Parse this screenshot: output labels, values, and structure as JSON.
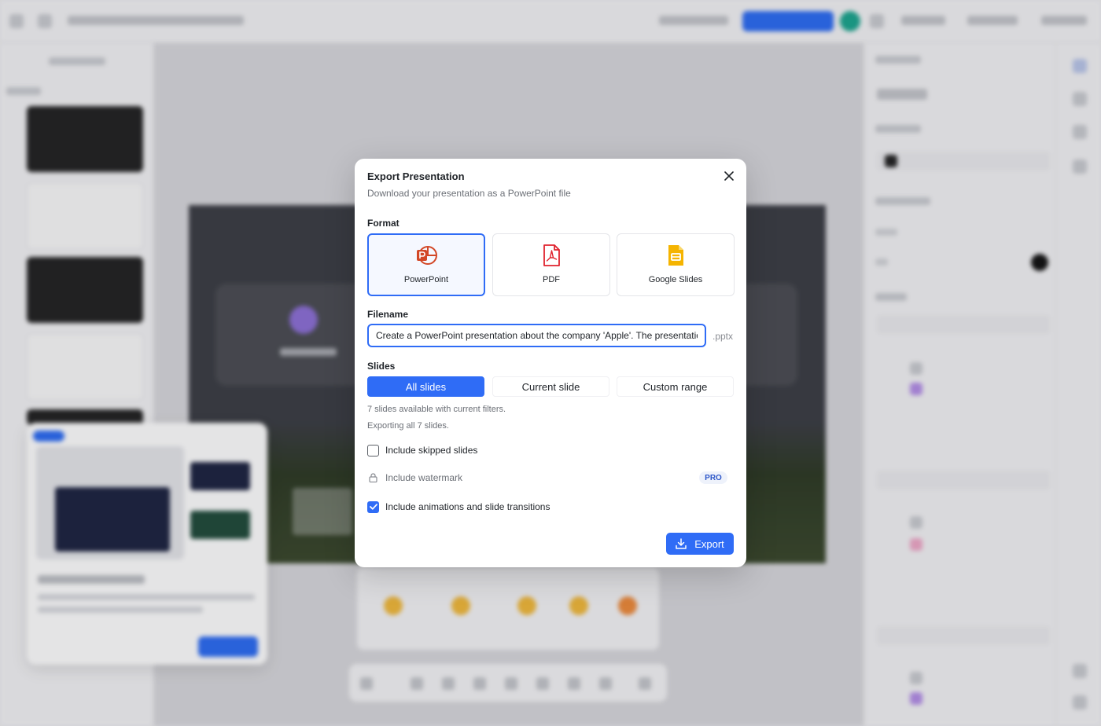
{
  "dialog": {
    "title": "Export Presentation",
    "subtitle": "Download your presentation as a PowerPoint file",
    "format_label": "Format",
    "formats": [
      {
        "label": "PowerPoint",
        "icon": "powerpoint-icon",
        "selected": true
      },
      {
        "label": "PDF",
        "icon": "pdf-icon",
        "selected": false
      },
      {
        "label": "Google Slides",
        "icon": "google-slides-icon",
        "selected": false
      }
    ],
    "filename_label": "Filename",
    "filename_value": "Create a PowerPoint presentation about the company 'Apple'. The presentation",
    "filename_ext": ".pptx",
    "slides_label": "Slides",
    "slide_options": [
      {
        "label": "All slides",
        "active": true
      },
      {
        "label": "Current slide",
        "active": false
      },
      {
        "label": "Custom range",
        "active": false
      }
    ],
    "info_available": "7 slides available with current filters.",
    "info_exporting": "Exporting all 7 slides.",
    "options": {
      "include_skipped": {
        "label": "Include skipped slides",
        "checked": false
      },
      "include_watermark": {
        "label": "Include watermark",
        "locked": true,
        "badge": "PRO"
      },
      "include_animations": {
        "label": "Include animations and slide transitions",
        "checked": true
      }
    },
    "export_label": "Export"
  },
  "colors": {
    "accent": "#2f6cf6",
    "powerpoint": "#d24726",
    "pdf": "#e0232e",
    "google_slides": "#f5b400"
  }
}
